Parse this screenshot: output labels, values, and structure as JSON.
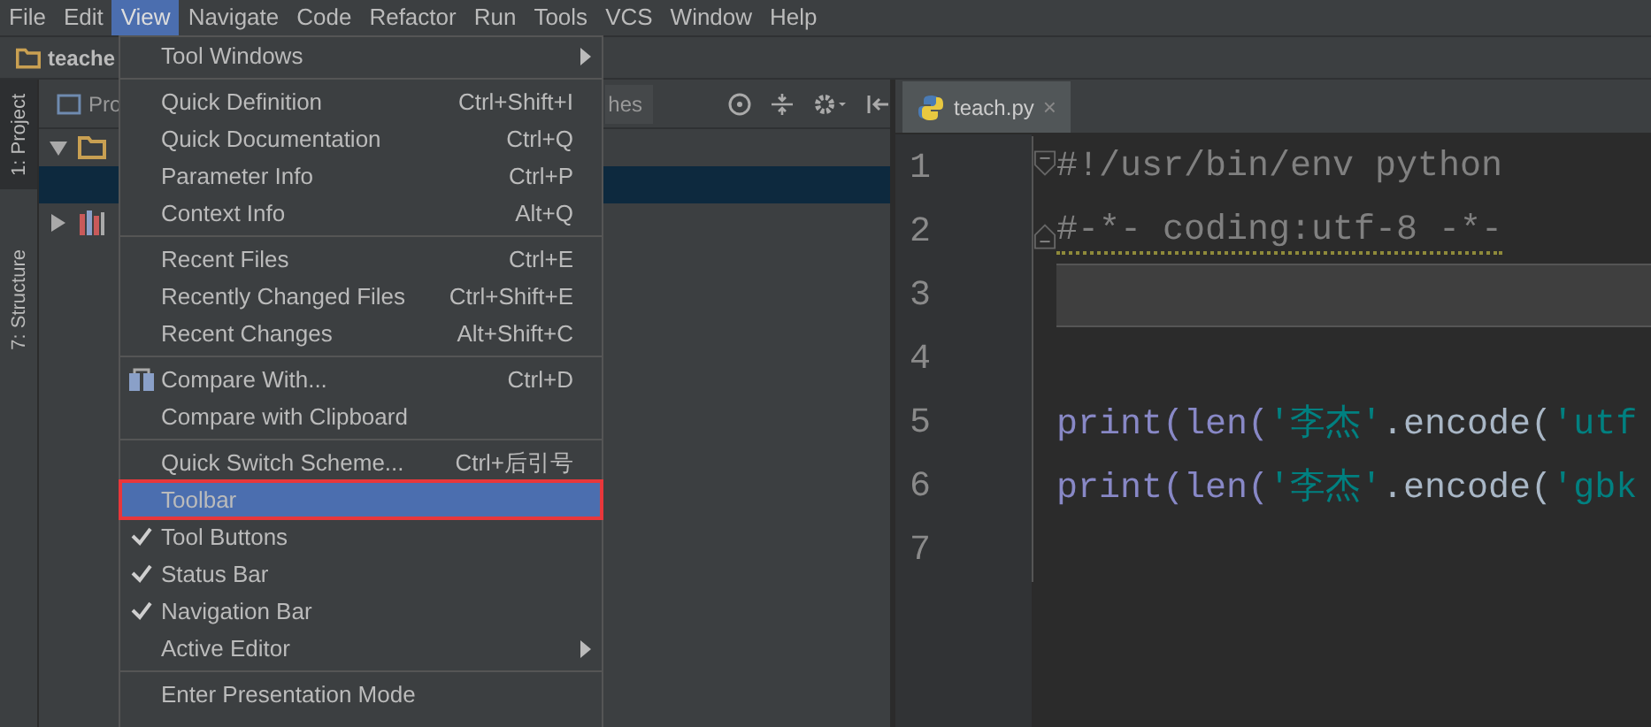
{
  "menu_bar": [
    {
      "label": "File",
      "selected": false
    },
    {
      "label": "Edit",
      "selected": false
    },
    {
      "label": "View",
      "selected": true
    },
    {
      "label": "Navigate",
      "selected": false
    },
    {
      "label": "Code",
      "selected": false
    },
    {
      "label": "Refactor",
      "selected": false
    },
    {
      "label": "Run",
      "selected": false
    },
    {
      "label": "Tools",
      "selected": false
    },
    {
      "label": "VCS",
      "selected": false
    },
    {
      "label": "Window",
      "selected": false
    },
    {
      "label": "Help",
      "selected": false
    }
  ],
  "navigation_bar": {
    "project": "teache"
  },
  "tool_strip": [
    {
      "label": "1: Project",
      "selected": true
    },
    {
      "label": "7: Structure",
      "selected": false
    }
  ],
  "project_panel": {
    "tab": "Pro",
    "tab_2": "hes",
    "tree": [
      {
        "expanded": true,
        "selected": false,
        "kind": "folder"
      },
      {
        "selected": true,
        "kind": "blank"
      },
      {
        "expanded": false,
        "selected": false,
        "kind": "library"
      }
    ]
  },
  "editor": {
    "tab": {
      "title": "teach.py",
      "close": "×"
    },
    "lines": [
      {
        "number": "1",
        "fold_open": true,
        "warning": false,
        "current": false,
        "tokens": [
          {
            "text": "#!/usr/bin/env python",
            "kind": "comment"
          }
        ]
      },
      {
        "number": "2",
        "fold_close": true,
        "warning": true,
        "current": false,
        "tokens": [
          {
            "text": "#-*- coding:utf-8 -*-",
            "kind": "comment"
          }
        ]
      },
      {
        "number": "3",
        "current": true
      },
      {
        "number": "4",
        "current": false
      },
      {
        "number": "5",
        "warning": false,
        "current": false,
        "tokens": [
          {
            "text": "print(len(",
            "kind": "builtin"
          },
          {
            "text": "'李杰'",
            "kind": "string"
          },
          {
            "text": ".encode(",
            "kind": "plain"
          },
          {
            "text": "'utf",
            "kind": "string"
          }
        ]
      },
      {
        "number": "6",
        "warning": false,
        "current": false,
        "tokens": [
          {
            "text": "print(len(",
            "kind": "builtin"
          },
          {
            "text": "'李杰'",
            "kind": "string"
          },
          {
            "text": ".encode(",
            "kind": "plain"
          },
          {
            "text": "'gbk",
            "kind": "string"
          }
        ]
      },
      {
        "number": "7",
        "current": false
      }
    ]
  },
  "view_menu": [
    {
      "kind": "item",
      "label": "Tool Windows",
      "submenu": true,
      "checked": false,
      "selected": false,
      "highlighted": false
    },
    {
      "kind": "separator"
    },
    {
      "kind": "item",
      "label": "Quick Definition",
      "shortcut": "Ctrl+Shift+I",
      "checked": false,
      "selected": false,
      "highlighted": false
    },
    {
      "kind": "item",
      "label": "Quick Documentation",
      "shortcut": "Ctrl+Q",
      "checked": false,
      "selected": false,
      "highlighted": false
    },
    {
      "kind": "item",
      "label": "Parameter Info",
      "shortcut": "Ctrl+P",
      "checked": false,
      "selected": false,
      "highlighted": false
    },
    {
      "kind": "item",
      "label": "Context Info",
      "shortcut": "Alt+Q",
      "checked": false,
      "selected": false,
      "highlighted": false
    },
    {
      "kind": "separator"
    },
    {
      "kind": "item",
      "label": "Recent Files",
      "shortcut": "Ctrl+E",
      "checked": false,
      "selected": false,
      "highlighted": false
    },
    {
      "kind": "item",
      "label": "Recently Changed Files",
      "shortcut": "Ctrl+Shift+E",
      "checked": false,
      "selected": false,
      "highlighted": false
    },
    {
      "kind": "item",
      "label": "Recent Changes",
      "shortcut": "Alt+Shift+C",
      "checked": false,
      "selected": false,
      "highlighted": false
    },
    {
      "kind": "separator"
    },
    {
      "kind": "item",
      "label": "Compare With...",
      "shortcut": "Ctrl+D",
      "icon": true,
      "checked": false,
      "selected": false,
      "highlighted": false
    },
    {
      "kind": "item",
      "label": "Compare with Clipboard",
      "checked": false,
      "selected": false,
      "highlighted": false
    },
    {
      "kind": "separator"
    },
    {
      "kind": "item",
      "label": "Quick Switch Scheme...",
      "shortcut": "Ctrl+后引号",
      "checked": false,
      "selected": false,
      "highlighted": false
    },
    {
      "kind": "item",
      "label": "Toolbar",
      "checked": false,
      "selected": true,
      "highlighted": true
    },
    {
      "kind": "item",
      "label": "Tool Buttons",
      "checked": true,
      "selected": false,
      "highlighted": false
    },
    {
      "kind": "item",
      "label": "Status Bar",
      "checked": true,
      "selected": false,
      "highlighted": false
    },
    {
      "kind": "item",
      "label": "Navigation Bar",
      "checked": true,
      "selected": false,
      "highlighted": false
    },
    {
      "kind": "item",
      "label": "Active Editor",
      "submenu": true,
      "checked": false,
      "selected": false,
      "highlighted": false
    },
    {
      "kind": "separator"
    },
    {
      "kind": "item",
      "label": "Enter Presentation Mode",
      "checked": false,
      "selected": false,
      "highlighted": false
    }
  ]
}
